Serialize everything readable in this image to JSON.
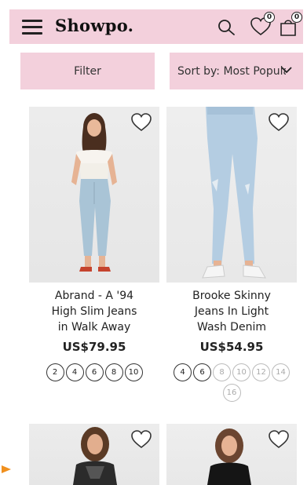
{
  "header": {
    "menu_icon": "hamburger-icon",
    "logo": "Showpo.",
    "search_icon": "search-icon",
    "wishlist_icon": "heart-icon",
    "wishlist_count": "0",
    "bag_icon": "shopping-bag-icon",
    "bag_count": "0",
    "background": "#f3d0dc"
  },
  "controls": {
    "filter_label": "Filter",
    "sort_label": "Sort by: Most Popular"
  },
  "products": [
    {
      "title_lines": [
        "Abrand - A '94",
        "High Slim Jeans",
        "in Walk Away"
      ],
      "price": "US$79.95",
      "sizes": [
        {
          "label": "2",
          "available": true
        },
        {
          "label": "4",
          "available": true
        },
        {
          "label": "6",
          "available": true
        },
        {
          "label": "8",
          "available": true
        },
        {
          "label": "10",
          "available": true
        }
      ]
    },
    {
      "title_lines": [
        "Brooke Skinny",
        "Jeans In Light",
        "Wash Denim"
      ],
      "price": "US$54.95",
      "sizes": [
        {
          "label": "4",
          "available": true
        },
        {
          "label": "6",
          "available": true
        },
        {
          "label": "8",
          "available": false
        },
        {
          "label": "10",
          "available": false
        },
        {
          "label": "12",
          "available": false
        },
        {
          "label": "14",
          "available": false
        },
        {
          "label": "16",
          "available": false
        }
      ]
    }
  ],
  "colors": {
    "pink": "#f3d0dc",
    "arrow": "#f0901e"
  }
}
